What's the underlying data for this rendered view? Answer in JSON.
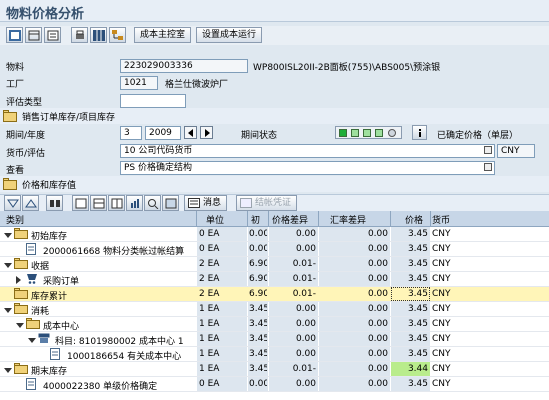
{
  "title": "物料价格分析",
  "toolbar": {
    "btn_cost_console": "成本主控室",
    "btn_cost_run": "设置成本运行"
  },
  "header": {
    "material_label": "物料",
    "material_value": "223029003336",
    "material_desc": "WP800ISL20II-2B面板(755)\\ABS005\\预涂银",
    "plant_label": "工厂",
    "plant_value": "1021",
    "plant_desc": "格兰仕微波炉厂",
    "valtype_label": "评估类型",
    "valtype_value": "",
    "sales_order_label": "销售订单库存/项目库存",
    "period_label": "期间/年度",
    "period_value": "3",
    "year_value": "2009",
    "period_status_label": "期间状态",
    "price_label": "已确定价格（单层）",
    "currency_label": "货币/评估",
    "currency_value": "10 公司代码货币",
    "currency_code": "CNY",
    "view_label": "查看",
    "view_value": "PS 价格确定结构"
  },
  "section": {
    "label": "价格和库存值"
  },
  "alv_toolbar": {
    "message_label": "消息",
    "settle_label": "结帐凭证"
  },
  "grid": {
    "columns": {
      "category": "类别",
      "unit": "单位",
      "initial": "初",
      "price_diff": "价格差异",
      "fx_diff": "汇率差异",
      "price": "价格",
      "currency": "货币"
    },
    "rows": [
      {
        "indent": 0,
        "kind": "folder-open",
        "category": "初始库存",
        "unit": "0 EA",
        "initial": "0.00",
        "price_diff": "0.00",
        "fx_diff": "0.00",
        "price": "3.45",
        "currency": "CNY"
      },
      {
        "indent": 1,
        "kind": "doc",
        "category": "2000061668 物料分类帐过帐结算",
        "unit": "0 EA",
        "initial": "0.00",
        "price_diff": "0.00",
        "fx_diff": "0.00",
        "price": "3.45",
        "currency": "CNY"
      },
      {
        "indent": 0,
        "kind": "folder-open",
        "category": "收据",
        "unit": "2 EA",
        "initial": "6.90",
        "price_diff": "0.01-",
        "fx_diff": "0.00",
        "price": "3.45",
        "currency": "CNY"
      },
      {
        "indent": 1,
        "kind": "cart",
        "category": "采购订单",
        "unit": "2 EA",
        "initial": "6.90",
        "price_diff": "0.01-",
        "fx_diff": "0.00",
        "price": "3.45",
        "currency": "CNY"
      },
      {
        "indent": 0,
        "kind": "folder",
        "category": "库存累计",
        "unit": "2 EA",
        "initial": "6.90",
        "price_diff": "0.01-",
        "fx_diff": "0.00",
        "price": "3.45",
        "currency": "CNY",
        "selected": true
      },
      {
        "indent": 0,
        "kind": "folder-open",
        "category": "消耗",
        "unit": "1 EA",
        "initial": "3.45",
        "price_diff": "0.00",
        "fx_diff": "0.00",
        "price": "3.45",
        "currency": "CNY"
      },
      {
        "indent": 1,
        "kind": "folder-open",
        "category": "成本中心",
        "unit": "1 EA",
        "initial": "3.45",
        "price_diff": "0.00",
        "fx_diff": "0.00",
        "price": "3.45",
        "currency": "CNY"
      },
      {
        "indent": 2,
        "kind": "account",
        "category": "科目: 8101980002 成本中心 1",
        "unit": "1 EA",
        "initial": "3.45",
        "price_diff": "0.00",
        "fx_diff": "0.00",
        "price": "3.45",
        "currency": "CNY"
      },
      {
        "indent": 3,
        "kind": "doc",
        "category": "1000186654 有关成本中心",
        "unit": "1 EA",
        "initial": "3.45",
        "price_diff": "0.00",
        "fx_diff": "0.00",
        "price": "3.45",
        "currency": "CNY"
      },
      {
        "indent": 0,
        "kind": "folder-open",
        "category": "期末库存",
        "unit": "1 EA",
        "initial": "3.45",
        "price_diff": "0.01-",
        "fx_diff": "0.00",
        "price": "3.44",
        "currency": "CNY",
        "green": true
      },
      {
        "indent": 1,
        "kind": "doc",
        "category": "4000022380 单级价格确定",
        "unit": "0 EA",
        "initial": "0.00",
        "price_diff": "0.00",
        "fx_diff": "0.00",
        "price": "3.45",
        "currency": "CNY"
      }
    ]
  },
  "colors": {
    "title": "#35506d",
    "header_bg": "#c7d6e7",
    "selected_row": "#fff5b8",
    "green_cell": "#b9ec8c"
  }
}
